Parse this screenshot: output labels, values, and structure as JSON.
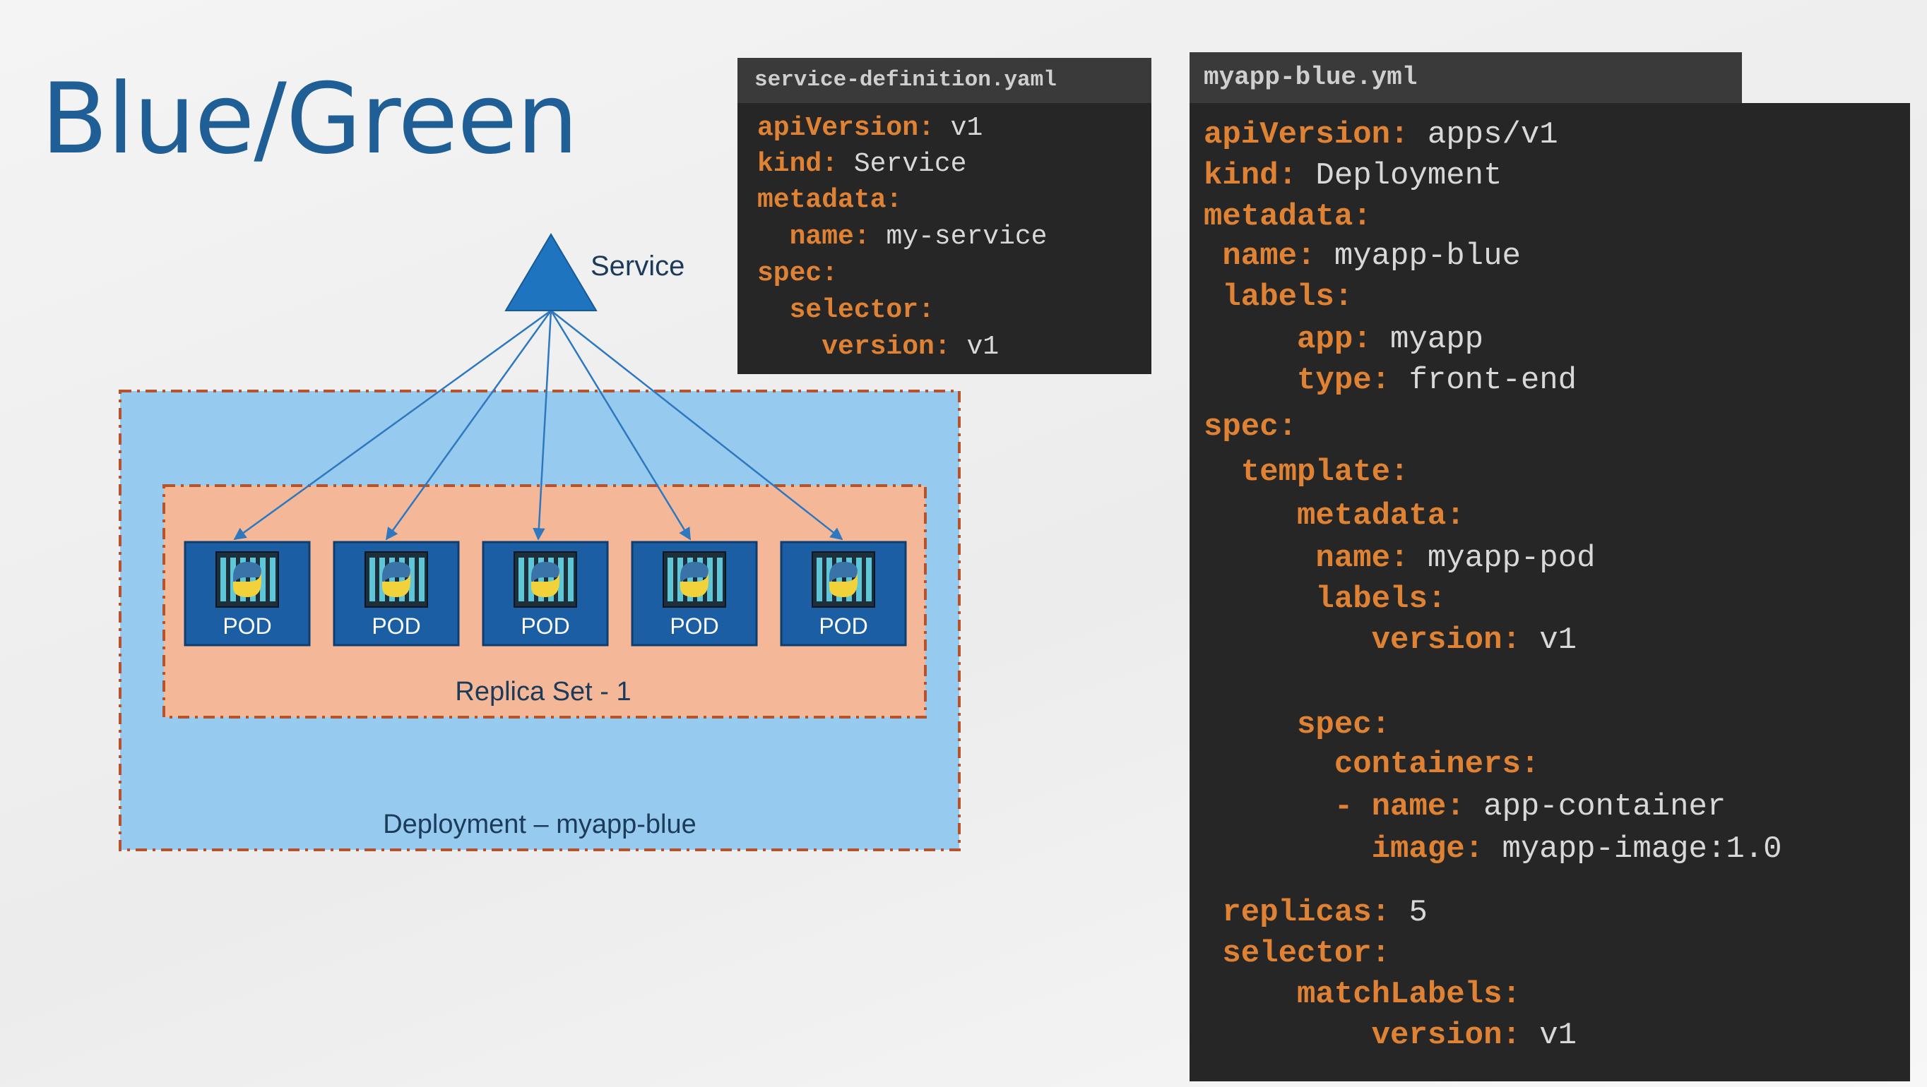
{
  "title": "Blue/Green",
  "diagram": {
    "service_label": "Service",
    "pod_label": "POD",
    "pod_count": 5,
    "replicaset_label": "Replica Set - 1",
    "deployment_label": "Deployment – myapp-blue",
    "colors": {
      "service": "#1f74c0",
      "deployment_fill": "#96cbef",
      "replicaset_fill": "#f4b899",
      "pod_fill": "#1b5ea3",
      "border": "#b5542c",
      "arrow": "#2d78bf"
    }
  },
  "service_file": {
    "filename": "service-definition.yaml",
    "lines": [
      {
        "key": "apiVersion:",
        "value": " v1"
      },
      {
        "key": "kind:",
        "value": " Service"
      },
      {
        "key": "metadata:",
        "value": ""
      },
      {
        "key": "  name:",
        "value": " my-service"
      },
      {
        "key": "spec:",
        "value": ""
      },
      {
        "key": "  selector:",
        "value": ""
      },
      {
        "key": "    version:",
        "value": " v1"
      }
    ]
  },
  "deployment_file": {
    "filename": "myapp-blue.yml",
    "lines": [
      {
        "key": "apiVersion:",
        "value": " apps/v1"
      },
      {
        "key": "kind:",
        "value": " Deployment"
      },
      {
        "key": "metadata:",
        "value": ""
      },
      {
        "key": " name:",
        "value": " myapp-blue"
      },
      {
        "key": " labels:",
        "value": ""
      },
      {
        "key": "     app:",
        "value": " myapp"
      },
      {
        "key": "     type:",
        "value": " front-end"
      },
      {
        "key": "spec:",
        "value": ""
      },
      {
        "key": "  template:",
        "value": ""
      },
      {
        "key": "     metadata:",
        "value": ""
      },
      {
        "key": "      name:",
        "value": " myapp-pod"
      },
      {
        "key": "      labels:",
        "value": ""
      },
      {
        "key": "         version:",
        "value": " v1"
      },
      {
        "key": "     spec:",
        "value": ""
      },
      {
        "key": "       containers:",
        "value": ""
      },
      {
        "key": "       - name:",
        "value": " app-container"
      },
      {
        "key": "         image:",
        "value": " myapp-image:1.0"
      },
      {
        "key": " replicas:",
        "value": " 5"
      },
      {
        "key": " selector:",
        "value": ""
      },
      {
        "key": "     matchLabels:",
        "value": ""
      },
      {
        "key": "         version:",
        "value": " v1"
      }
    ]
  }
}
